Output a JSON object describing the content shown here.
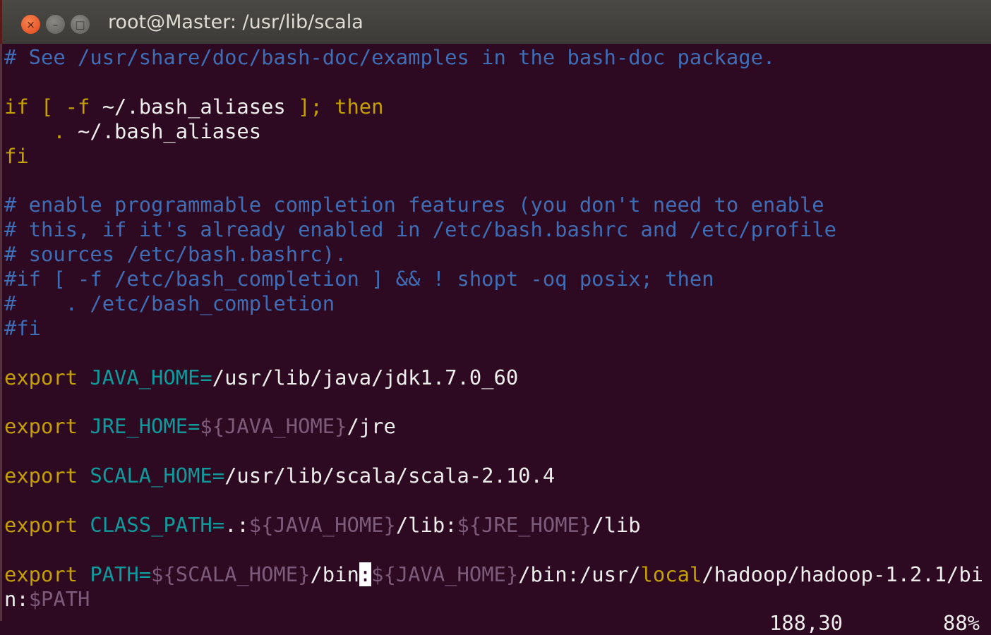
{
  "window": {
    "title": "root@Master: /usr/lib/scala",
    "close_icon": "×",
    "minimize_icon": "–",
    "maximize_icon": "□"
  },
  "colors": {
    "background": "#2d0922",
    "comment": "#3f6eb5",
    "keyword": "#c4a000",
    "identifier": "#0f9a9c",
    "variable": "#7d5c7b",
    "text": "#eeeeec"
  },
  "lines": [
    [
      [
        "comment",
        "# See /usr/share/doc/bash-doc/examples in the bash-doc package."
      ]
    ],
    [],
    [
      [
        "yellow",
        "if [ -f "
      ],
      [
        "white",
        "~/.bash_aliases"
      ],
      [
        "yellow",
        " ]; then"
      ]
    ],
    [
      [
        "white",
        "    "
      ],
      [
        "yellow",
        "."
      ],
      [
        "white",
        " ~/.bash_aliases"
      ]
    ],
    [
      [
        "yellow",
        "fi"
      ]
    ],
    [],
    [
      [
        "comment",
        "# enable programmable completion features (you don't need to enable"
      ]
    ],
    [
      [
        "comment",
        "# this, if it's already enabled in /etc/bash.bashrc and /etc/profile"
      ]
    ],
    [
      [
        "comment",
        "# sources /etc/bash.bashrc)."
      ]
    ],
    [
      [
        "comment",
        "#if [ -f /etc/bash_completion ] && ! shopt -oq posix; then"
      ]
    ],
    [
      [
        "comment",
        "#    . /etc/bash_completion"
      ]
    ],
    [
      [
        "comment",
        "#fi"
      ]
    ],
    [],
    [
      [
        "yellow",
        "export"
      ],
      [
        "white",
        " "
      ],
      [
        "cyan",
        "JAVA_HOME="
      ],
      [
        "white",
        "/usr/lib/java/jdk1.7.0_60"
      ]
    ],
    [],
    [
      [
        "yellow",
        "export"
      ],
      [
        "white",
        " "
      ],
      [
        "cyan",
        "JRE_HOME="
      ],
      [
        "var",
        "${JAVA_HOME}"
      ],
      [
        "white",
        "/jre"
      ]
    ],
    [],
    [
      [
        "yellow",
        "export"
      ],
      [
        "white",
        " "
      ],
      [
        "cyan",
        "SCALA_HOME="
      ],
      [
        "white",
        "/usr/lib/scala/scala-2.10.4"
      ]
    ],
    [],
    [
      [
        "yellow",
        "export"
      ],
      [
        "white",
        " "
      ],
      [
        "cyan",
        "CLASS_PATH="
      ],
      [
        "white",
        ".:"
      ],
      [
        "var",
        "${JAVA_HOME}"
      ],
      [
        "white",
        "/lib:"
      ],
      [
        "var",
        "${JRE_HOME}"
      ],
      [
        "white",
        "/lib"
      ]
    ],
    [],
    [
      [
        "yellow",
        "export"
      ],
      [
        "white",
        " "
      ],
      [
        "cyan",
        "PATH="
      ],
      [
        "var",
        "${SCALA_HOME}"
      ],
      [
        "white",
        "/bin"
      ],
      [
        "cursor",
        ":"
      ],
      [
        "var",
        "${JAVA_HOME}"
      ],
      [
        "white",
        "/bin:/usr/"
      ],
      [
        "yellow",
        "local"
      ],
      [
        "white",
        "/hadoop/hadoop-1.2.1/bi"
      ]
    ],
    [
      [
        "white",
        "n:"
      ],
      [
        "var",
        "$PATH"
      ]
    ]
  ],
  "status": {
    "position": "188,30",
    "percent": "88%"
  }
}
